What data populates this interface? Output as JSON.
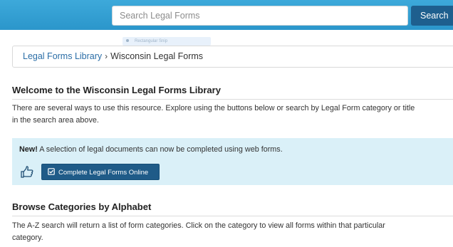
{
  "header": {
    "search_placeholder": "Search Legal Forms",
    "search_button_label": "Search",
    "ghost_tool_label": "Rectangular Snip"
  },
  "breadcrumb": {
    "items": [
      "Legal Forms Library",
      "Wisconsin Legal Forms"
    ],
    "separator": "›"
  },
  "welcome": {
    "heading": "Welcome to the Wisconsin Legal Forms Library",
    "body_line1": "There are several ways to use this resource. Explore using the buttons below or search by Legal Form category or title",
    "body_line2": "in the search area above."
  },
  "promo": {
    "new_label": "New!",
    "text": " A selection of legal documents can now be completed using web forms.",
    "button_label": "Complete Legal Forms Online",
    "thumb_icon": "hand-pointing-right-icon",
    "button_icon": "check-square-icon"
  },
  "browse": {
    "heading": "Browse Categories by Alphabet",
    "body_line1": "The A-Z search will return a list of form categories. Click on the category to view all forms within that particular",
    "body_line2": "category."
  },
  "colors": {
    "header_bar": "#2b96cb",
    "button_dark": "#1f5b88",
    "link": "#2a6da6",
    "promo_bg": "#daf0f8"
  }
}
